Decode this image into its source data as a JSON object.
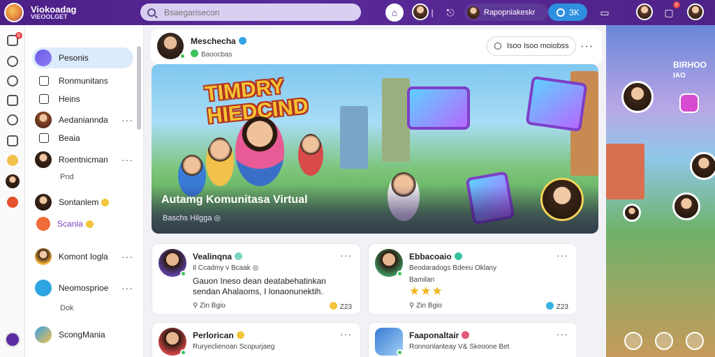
{
  "app": {
    "brand_line1": "Viokoadag",
    "brand_line2": "VIEOOLGET"
  },
  "topbar": {
    "search_placeholder": "Bsaegarisecon",
    "profile_name": "Rapopniakeskr",
    "action_label": "ЗК",
    "notification_count": "6"
  },
  "rail": {
    "badge_count": "6"
  },
  "sidebar": {
    "items": [
      {
        "label": "Pesonis"
      },
      {
        "label": "Ronmunitans"
      },
      {
        "label": "Heins"
      },
      {
        "label": "Aedaniannda"
      },
      {
        "label": "Beaia"
      },
      {
        "label": "Roentnicman",
        "sub": "Pnd"
      },
      {
        "label": "Sontanlem"
      },
      {
        "label": "Scania"
      },
      {
        "label": "Komont Iogla"
      },
      {
        "label": "Neomosprioe",
        "sub": "Dok"
      },
      {
        "label": "ScongMania"
      }
    ]
  },
  "post_header": {
    "name": "Meschecha",
    "sub": "Baoocbas",
    "search_label": "Isoo  Isoo  moiobss"
  },
  "hero": {
    "title": "TIMDRY HIEDCIND",
    "caption": "Autamg Komunitasa Virtual",
    "sub": "Baschs  Hilgga  ◎"
  },
  "cards": [
    {
      "name": "Vealinqna",
      "meta": "Il Ccadmy v  Bcaak  ◎",
      "body": "Gauon Ineso dean deatabehatinkan\nsendan Ahalaoms, I lonaonunektih.",
      "foot": "Zin Bgio",
      "count": "Z23"
    },
    {
      "name": "Ebbacoaio",
      "meta": "Beodaradogs  Bdeeu Oklany",
      "sub": "Bamilan",
      "foot": "Zin Bgio",
      "count": "Z23"
    },
    {
      "name": "Perlorican",
      "meta": "Ruryeclienoan  Scopurjaeg"
    },
    {
      "name": "Faaponaltair",
      "meta": "Ronnonlanteay  V& Skeoone Bet"
    }
  ],
  "right_panel": {
    "title_line1": "BIRHOO",
    "title_line2": "IAO"
  },
  "colors": {
    "topbar": "#4b1f86",
    "accent_blue": "#2f8fe0",
    "active_item": "#dcebfb",
    "hero_title": "#f6c133"
  }
}
